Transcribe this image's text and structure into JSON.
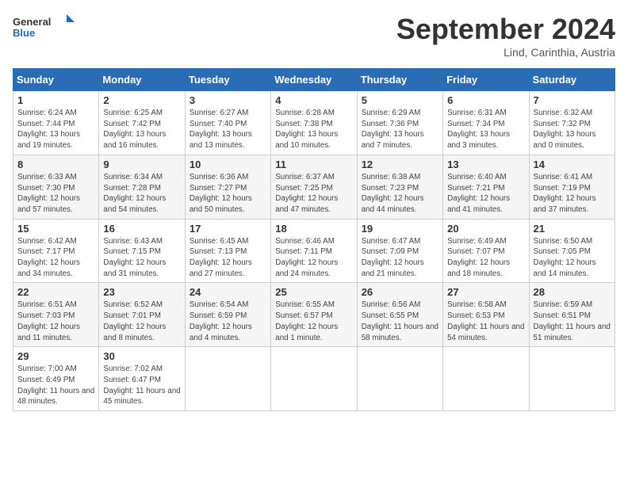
{
  "header": {
    "logo_general": "General",
    "logo_blue": "Blue",
    "month_title": "September 2024",
    "location": "Lind, Carinthia, Austria"
  },
  "days_of_week": [
    "Sunday",
    "Monday",
    "Tuesday",
    "Wednesday",
    "Thursday",
    "Friday",
    "Saturday"
  ],
  "weeks": [
    [
      {
        "day": "1",
        "sunrise": "Sunrise: 6:24 AM",
        "sunset": "Sunset: 7:44 PM",
        "daylight": "Daylight: 13 hours and 19 minutes."
      },
      {
        "day": "2",
        "sunrise": "Sunrise: 6:25 AM",
        "sunset": "Sunset: 7:42 PM",
        "daylight": "Daylight: 13 hours and 16 minutes."
      },
      {
        "day": "3",
        "sunrise": "Sunrise: 6:27 AM",
        "sunset": "Sunset: 7:40 PM",
        "daylight": "Daylight: 13 hours and 13 minutes."
      },
      {
        "day": "4",
        "sunrise": "Sunrise: 6:28 AM",
        "sunset": "Sunset: 7:38 PM",
        "daylight": "Daylight: 13 hours and 10 minutes."
      },
      {
        "day": "5",
        "sunrise": "Sunrise: 6:29 AM",
        "sunset": "Sunset: 7:36 PM",
        "daylight": "Daylight: 13 hours and 7 minutes."
      },
      {
        "day": "6",
        "sunrise": "Sunrise: 6:31 AM",
        "sunset": "Sunset: 7:34 PM",
        "daylight": "Daylight: 13 hours and 3 minutes."
      },
      {
        "day": "7",
        "sunrise": "Sunrise: 6:32 AM",
        "sunset": "Sunset: 7:32 PM",
        "daylight": "Daylight: 13 hours and 0 minutes."
      }
    ],
    [
      {
        "day": "8",
        "sunrise": "Sunrise: 6:33 AM",
        "sunset": "Sunset: 7:30 PM",
        "daylight": "Daylight: 12 hours and 57 minutes."
      },
      {
        "day": "9",
        "sunrise": "Sunrise: 6:34 AM",
        "sunset": "Sunset: 7:28 PM",
        "daylight": "Daylight: 12 hours and 54 minutes."
      },
      {
        "day": "10",
        "sunrise": "Sunrise: 6:36 AM",
        "sunset": "Sunset: 7:27 PM",
        "daylight": "Daylight: 12 hours and 50 minutes."
      },
      {
        "day": "11",
        "sunrise": "Sunrise: 6:37 AM",
        "sunset": "Sunset: 7:25 PM",
        "daylight": "Daylight: 12 hours and 47 minutes."
      },
      {
        "day": "12",
        "sunrise": "Sunrise: 6:38 AM",
        "sunset": "Sunset: 7:23 PM",
        "daylight": "Daylight: 12 hours and 44 minutes."
      },
      {
        "day": "13",
        "sunrise": "Sunrise: 6:40 AM",
        "sunset": "Sunset: 7:21 PM",
        "daylight": "Daylight: 12 hours and 41 minutes."
      },
      {
        "day": "14",
        "sunrise": "Sunrise: 6:41 AM",
        "sunset": "Sunset: 7:19 PM",
        "daylight": "Daylight: 12 hours and 37 minutes."
      }
    ],
    [
      {
        "day": "15",
        "sunrise": "Sunrise: 6:42 AM",
        "sunset": "Sunset: 7:17 PM",
        "daylight": "Daylight: 12 hours and 34 minutes."
      },
      {
        "day": "16",
        "sunrise": "Sunrise: 6:43 AM",
        "sunset": "Sunset: 7:15 PM",
        "daylight": "Daylight: 12 hours and 31 minutes."
      },
      {
        "day": "17",
        "sunrise": "Sunrise: 6:45 AM",
        "sunset": "Sunset: 7:13 PM",
        "daylight": "Daylight: 12 hours and 27 minutes."
      },
      {
        "day": "18",
        "sunrise": "Sunrise: 6:46 AM",
        "sunset": "Sunset: 7:11 PM",
        "daylight": "Daylight: 12 hours and 24 minutes."
      },
      {
        "day": "19",
        "sunrise": "Sunrise: 6:47 AM",
        "sunset": "Sunset: 7:09 PM",
        "daylight": "Daylight: 12 hours and 21 minutes."
      },
      {
        "day": "20",
        "sunrise": "Sunrise: 6:49 AM",
        "sunset": "Sunset: 7:07 PM",
        "daylight": "Daylight: 12 hours and 18 minutes."
      },
      {
        "day": "21",
        "sunrise": "Sunrise: 6:50 AM",
        "sunset": "Sunset: 7:05 PM",
        "daylight": "Daylight: 12 hours and 14 minutes."
      }
    ],
    [
      {
        "day": "22",
        "sunrise": "Sunrise: 6:51 AM",
        "sunset": "Sunset: 7:03 PM",
        "daylight": "Daylight: 12 hours and 11 minutes."
      },
      {
        "day": "23",
        "sunrise": "Sunrise: 6:52 AM",
        "sunset": "Sunset: 7:01 PM",
        "daylight": "Daylight: 12 hours and 8 minutes."
      },
      {
        "day": "24",
        "sunrise": "Sunrise: 6:54 AM",
        "sunset": "Sunset: 6:59 PM",
        "daylight": "Daylight: 12 hours and 4 minutes."
      },
      {
        "day": "25",
        "sunrise": "Sunrise: 6:55 AM",
        "sunset": "Sunset: 6:57 PM",
        "daylight": "Daylight: 12 hours and 1 minute."
      },
      {
        "day": "26",
        "sunrise": "Sunrise: 6:56 AM",
        "sunset": "Sunset: 6:55 PM",
        "daylight": "Daylight: 11 hours and 58 minutes."
      },
      {
        "day": "27",
        "sunrise": "Sunrise: 6:58 AM",
        "sunset": "Sunset: 6:53 PM",
        "daylight": "Daylight: 11 hours and 54 minutes."
      },
      {
        "day": "28",
        "sunrise": "Sunrise: 6:59 AM",
        "sunset": "Sunset: 6:51 PM",
        "daylight": "Daylight: 11 hours and 51 minutes."
      }
    ],
    [
      {
        "day": "29",
        "sunrise": "Sunrise: 7:00 AM",
        "sunset": "Sunset: 6:49 PM",
        "daylight": "Daylight: 11 hours and 48 minutes."
      },
      {
        "day": "30",
        "sunrise": "Sunrise: 7:02 AM",
        "sunset": "Sunset: 6:47 PM",
        "daylight": "Daylight: 11 hours and 45 minutes."
      },
      null,
      null,
      null,
      null,
      null
    ]
  ]
}
